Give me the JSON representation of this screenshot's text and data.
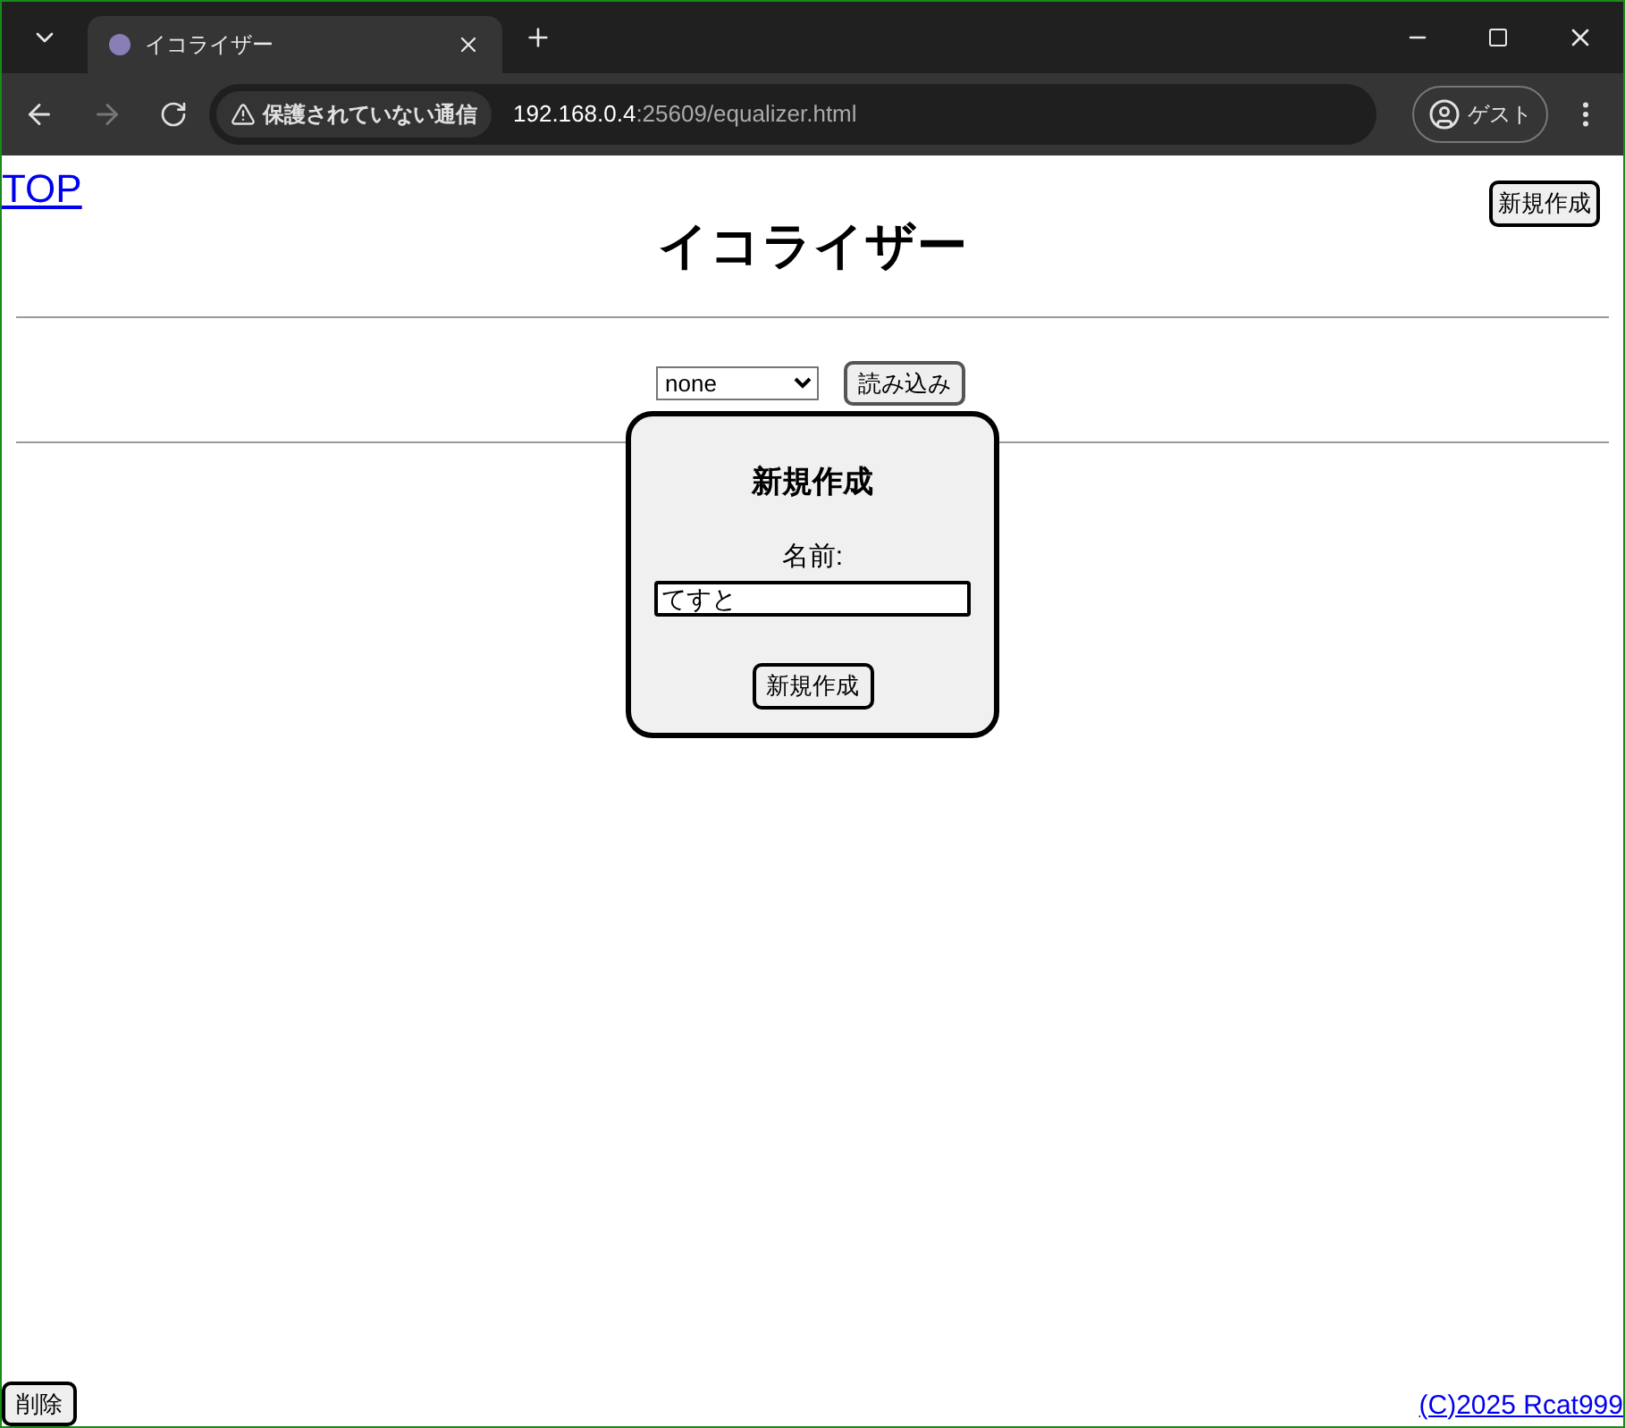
{
  "browser": {
    "tabs": [
      {
        "title": "イコライザー",
        "selected": true
      }
    ],
    "security_label": "保護されていない通信",
    "url_host": "192.168.0.4",
    "url_rest": ":25609/equalizer.html",
    "profile_label": "ゲスト"
  },
  "page": {
    "top_link": "TOP",
    "new_button": "新規作成",
    "title": "イコライザー",
    "preset_select": {
      "value": "none"
    },
    "load_button": "読み込み",
    "delete_button": "削除",
    "copyright_link": "(C)2025 Rcat999"
  },
  "dialog": {
    "title": "新規作成",
    "name_label": "名前:",
    "name_value": "てすと",
    "submit_button": "新規作成"
  }
}
